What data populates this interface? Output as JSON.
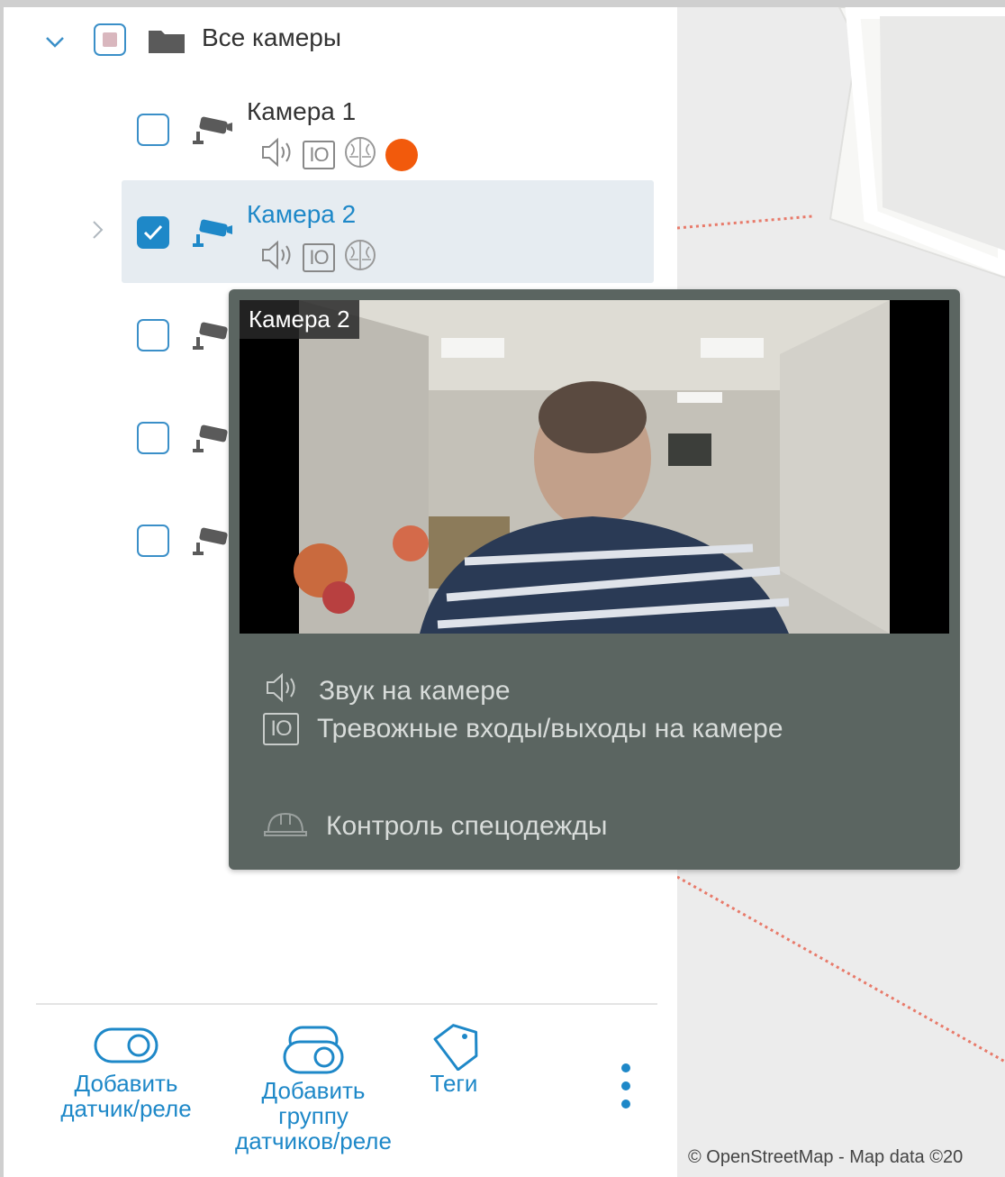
{
  "tree": {
    "root": {
      "label": "Все камеры",
      "checked": "partial",
      "expanded": true
    },
    "cameras": [
      {
        "name": "Камера 1",
        "checked": false,
        "features": [
          "sound-icon",
          "io-icon",
          "brain-icon",
          "recording-dot"
        ],
        "selected": false
      },
      {
        "name": "Камера 2",
        "checked": true,
        "features": [
          "sound-icon",
          "io-icon",
          "brain-icon"
        ],
        "selected": true
      },
      {
        "name": "",
        "checked": false
      },
      {
        "name": "",
        "checked": false
      },
      {
        "name": "",
        "checked": false
      }
    ],
    "io_label": "IO"
  },
  "popup": {
    "camera_title": "Камера 2",
    "items": [
      {
        "icon": "sound-icon",
        "text": "Звук на камере"
      },
      {
        "icon": "io-icon",
        "text": "Тревожные входы/выходы на камере"
      },
      {
        "icon": "hardhat-icon",
        "text": "Контроль спецодежды"
      }
    ]
  },
  "toolbar": {
    "add_sensor": "Добавить датчик/реле",
    "add_sensor_line1": "Добавить",
    "add_sensor_line2": "датчик/реле",
    "add_group_line1": "Добавить",
    "add_group_line2": "группу",
    "add_group_line3": "датчиков/реле",
    "tags": "Теги",
    "more": "more-vertical-icon"
  },
  "map": {
    "attribution": "© OpenStreetMap - Map data ©20"
  },
  "colors": {
    "accent": "#1e88c8",
    "recording": "#f25a0c",
    "popup_bg": "#5b6561",
    "selection_bg": "#e6ecf1"
  }
}
